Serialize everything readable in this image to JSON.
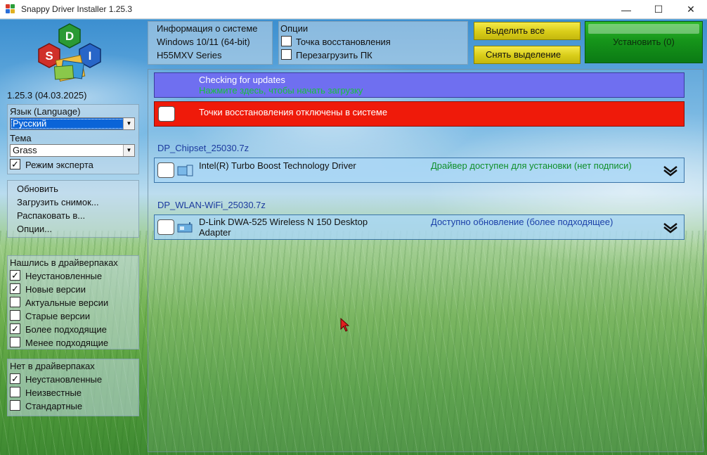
{
  "window": {
    "title": "Snappy Driver Installer 1.25.3",
    "minimize": "—",
    "maximize": "☐",
    "close": "✕"
  },
  "logo": {
    "letters": [
      "S",
      "D",
      "I"
    ]
  },
  "version": "1.25.3 (04.03.2025)",
  "language_panel": {
    "language_label": "Язык (Language)",
    "language_value": "Русский",
    "theme_label": "Тема",
    "theme_value": "Grass",
    "expert_mode_label": "Режим эксперта",
    "expert_mode_checked": true
  },
  "actions_menu": {
    "items": [
      "Обновить",
      "Загрузить снимок...",
      "Распаковать в...",
      "Опции..."
    ]
  },
  "found_panel": {
    "title": "Нашлись в драйверпаках",
    "filters": [
      {
        "label": "Неустановленные",
        "checked": true
      },
      {
        "label": "Новые версии",
        "checked": true
      },
      {
        "label": "Актуальные версии",
        "checked": false
      },
      {
        "label": "Старые версии",
        "checked": false
      },
      {
        "label": "Более подходящие",
        "checked": true
      },
      {
        "label": "Менее подходящие",
        "checked": false
      }
    ]
  },
  "notfound_panel": {
    "title": "Нет в драйверпаках",
    "filters": [
      {
        "label": "Неустановленные",
        "checked": true
      },
      {
        "label": "Неизвестные",
        "checked": false
      },
      {
        "label": "Стандартные",
        "checked": false
      }
    ]
  },
  "sysinfo": {
    "title": "Информация о системе",
    "os": "Windows 10/11 (64-bit)",
    "board": "H55MXV Series"
  },
  "options": {
    "title": "Опции",
    "restore_point_label": "Точка восстановления",
    "restore_point_checked": false,
    "reboot_label": "Перезагрузить ПК",
    "reboot_checked": false
  },
  "buttons": {
    "select_all": "Выделить все",
    "deselect": "Снять выделение",
    "install": "Установить (0)"
  },
  "updates_bar": {
    "title": "Checking for updates",
    "subtitle": "Нажмите здесь, чтобы начать загрузку"
  },
  "restore_warning": {
    "text": "Точки восстановления отключены в системе"
  },
  "packs": [
    {
      "name": "DP_Chipset_25030.7z",
      "driver": "Intel(R) Turbo Boost Technology Driver",
      "driver_line2": "",
      "status": "Драйвер доступен для установки (нет подписи)"
    },
    {
      "name": "DP_WLAN-WiFi_25030.7z",
      "driver": "D-Link DWA-525 Wireless N 150 Desktop",
      "driver_line2": "Adapter",
      "status": "Доступно обновление (более подходящее)"
    }
  ],
  "colors": {
    "updates_bg": "#6f6ff0",
    "updates_subtitle": "#18c23a",
    "warning_bg": "#ef1a0a",
    "pack_name": "#1b3a9e",
    "status_available": "#0f8f2a",
    "status_update": "#1a3fa8",
    "install_bg": "#16951a",
    "yellow_btn": "#d9cc18"
  }
}
